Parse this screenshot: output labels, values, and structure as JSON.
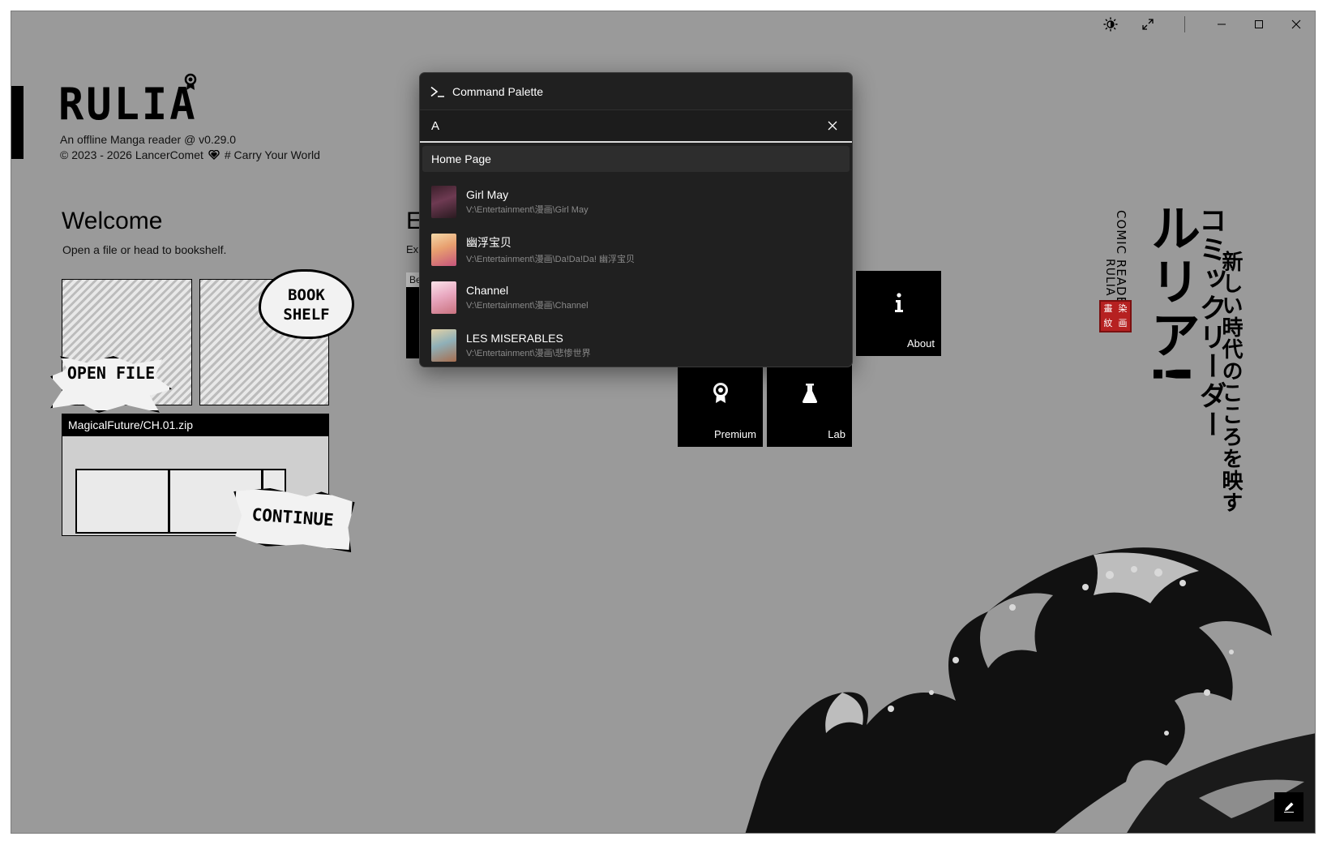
{
  "app": {
    "logo_text": "RULIA",
    "tagline": "An offline Manga reader @ v0.29.0",
    "copyright": "© 2023 - 2026 LancerComet",
    "motto": "# Carry Your World"
  },
  "welcome": {
    "title": "Welcome",
    "subtitle": "Open a file or head to bookshelf.",
    "open_file_label": "OPEN FILE",
    "bookshelf_label": "BOOK SHELF",
    "recent_file": "MagicalFuture/CH.01.zip",
    "continue_label": "CONTINUE"
  },
  "explore": {
    "title_partial": "Ex",
    "subtitle_partial": "Exp",
    "tab_partial": "Be",
    "tiles": {
      "about": "About",
      "premium": "Premium",
      "lab": "Lab"
    }
  },
  "decor": {
    "comic_reader": "COMIC READER",
    "rulia": "RULIA",
    "ruria_jp": "ルリア!",
    "comic_reader_jp": "コミックリーダー",
    "tagline_jp": "新しい時代のこころを映す"
  },
  "palette": {
    "title": "Command Palette",
    "query": "A",
    "group": "Home Page",
    "items": [
      {
        "title": "Girl May",
        "path": "V:\\Entertainment\\漫画\\Girl May"
      },
      {
        "title": "幽浮宝贝",
        "path": "V:\\Entertainment\\漫画\\Da!Da!Da! 幽浮宝贝"
      },
      {
        "title": "Channel",
        "path": "V:\\Entertainment\\漫画\\Channel"
      },
      {
        "title": "LES MISERABLES",
        "path": "V:\\Entertainment\\漫画\\悲惨世界"
      }
    ]
  },
  "colors": {
    "window_bg": "#9a9a9a",
    "palette_bg": "#202020",
    "tile_bg": "#000000",
    "seal": "#b62121"
  },
  "icons": {
    "theme": "brightness-icon",
    "fullscreen": "expand-icon",
    "minimize": "minimize-icon",
    "maximize": "maximize-icon",
    "close": "close-icon",
    "palette": "terminal-icon",
    "clear": "clear-icon",
    "about": "info-icon",
    "premium": "award-icon",
    "lab": "flask-icon",
    "edit": "pencil-icon"
  }
}
